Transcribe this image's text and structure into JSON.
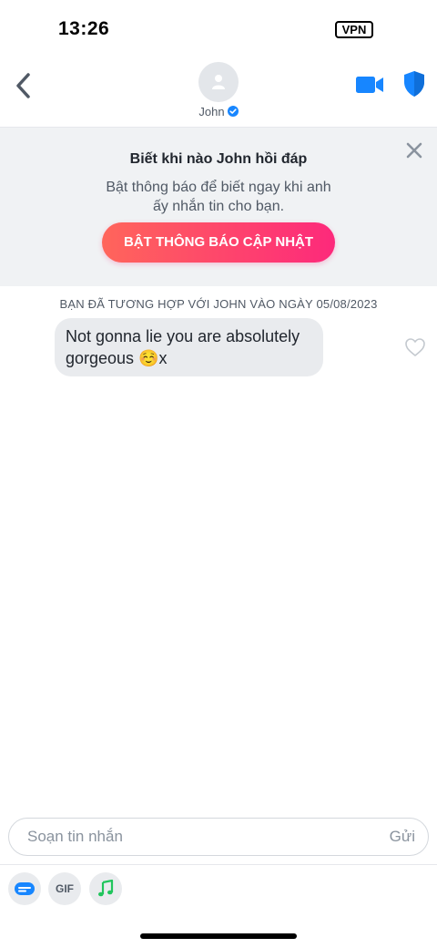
{
  "status_bar": {
    "time": "13:26",
    "vpn": "VPN"
  },
  "header": {
    "contact_name": "John"
  },
  "banner": {
    "title": "Biết khi nào John hồi đáp",
    "text": "Bật thông báo để biết ngay khi anh ấy nhắn tin cho bạn.",
    "button_label": "BẬT THÔNG BÁO CẬP NHẬT"
  },
  "conversation": {
    "match_info": "BẠN ĐÃ TƯƠNG HỢP VỚI JOHN VÀO NGÀY 05/08/2023",
    "messages": [
      {
        "text": "Not gonna lie you are absolutely gorgeous ☺️x"
      }
    ]
  },
  "composer": {
    "placeholder": "Soạn tin nhắn",
    "send_label": "Gửi"
  },
  "toolbar": {
    "gif_label": "GIF"
  },
  "colors": {
    "accent_blue": "#1786ff",
    "cta_gradient_start": "#ff655b",
    "cta_gradient_end": "#fd297b",
    "banner_bg": "#f0f2f4",
    "bubble_bg": "#e9ebee",
    "music_green": "#21c55d"
  },
  "icons": [
    "back-arrow-icon",
    "avatar-placeholder-icon",
    "verified-check-icon",
    "video-camera-icon",
    "shield-icon",
    "close-icon",
    "heart-outline-icon",
    "sticker-icon",
    "music-note-icon"
  ]
}
